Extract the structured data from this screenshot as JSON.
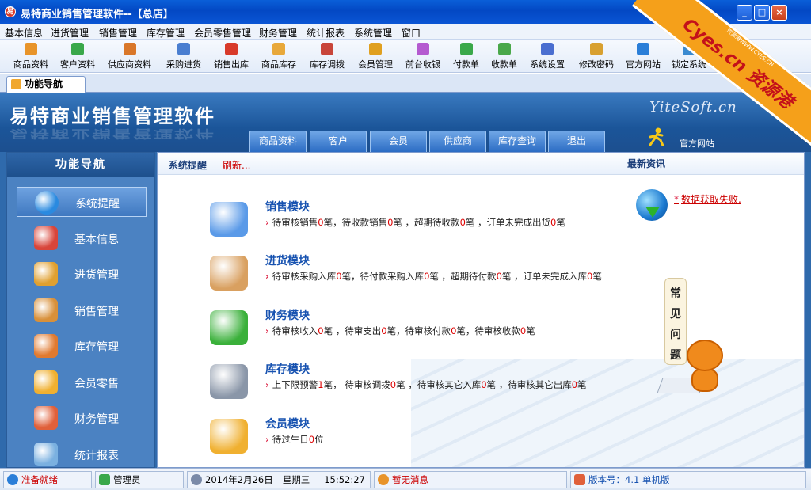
{
  "window": {
    "title": "易特商业销售管理软件--【总店】",
    "controls": [
      "_",
      "□",
      "×"
    ]
  },
  "menu": [
    "基本信息",
    "进货管理",
    "销售管理",
    "库存管理",
    "会员零售管理",
    "财务管理",
    "统计报表",
    "系统管理",
    "窗口"
  ],
  "toolbar": [
    {
      "label": "商品资料",
      "icon": "box-icon",
      "color": "#e8942a"
    },
    {
      "label": "客户资料",
      "icon": "customers-icon",
      "color": "#3aa84a"
    },
    {
      "label": "供应商资料",
      "icon": "supplier-icon",
      "color": "#d9772a"
    },
    {
      "label": "采购进货",
      "icon": "truck-icon",
      "color": "#4a7ed0"
    },
    {
      "label": "销售出库",
      "icon": "cart-icon",
      "color": "#d83a2a"
    },
    {
      "label": "商品库存",
      "icon": "inventory-icon",
      "color": "#e8a83a"
    },
    {
      "label": "库存调拨",
      "icon": "transfer-icon",
      "color": "#c8453a"
    },
    {
      "label": "会员管理",
      "icon": "member-icon",
      "color": "#e0a020"
    },
    {
      "label": "前台收银",
      "icon": "cashier-icon",
      "color": "#b45ad0"
    },
    {
      "label": "付款单",
      "icon": "payment-icon",
      "color": "#3aa84a"
    },
    {
      "label": "收款单",
      "icon": "receipt-icon",
      "color": "#4aa84a"
    },
    {
      "label": "系统设置",
      "icon": "settings-icon",
      "color": "#4a6ed0"
    },
    {
      "label": "修改密码",
      "icon": "key-icon",
      "color": "#d8a030"
    },
    {
      "label": "官方网站",
      "icon": "ie-icon",
      "color": "#2a7ed8"
    },
    {
      "label": "锁定系统",
      "icon": "lock-icon",
      "color": "#3a8ad0"
    }
  ],
  "watermark": {
    "main": "Cyes.cn 资源港",
    "sub": "资源港WWW.CYES.CN"
  },
  "tab": {
    "label": "功能导航"
  },
  "banner": {
    "brand": "易特商业销售管理软件",
    "site_logo": "YiteSoft.cn",
    "tabs": [
      "商品资料",
      "客户",
      "会员",
      "供应商",
      "库存查询",
      "退出"
    ],
    "official_site": "官方网站"
  },
  "sidebar": {
    "header": "功能导航",
    "items": [
      {
        "label": "系统提醒",
        "icon": "info-icon",
        "color": "#2a8ae0"
      },
      {
        "label": "基本信息",
        "icon": "cubes-icon",
        "color": "#d8453a"
      },
      {
        "label": "进货管理",
        "icon": "incoming-box-icon",
        "color": "#e0a030"
      },
      {
        "label": "销售管理",
        "icon": "outgoing-box-icon",
        "color": "#d8903a"
      },
      {
        "label": "库存管理",
        "icon": "warehouse-icon",
        "color": "#e07a30"
      },
      {
        "label": "会员零售",
        "icon": "member-chat-icon",
        "color": "#f0b030"
      },
      {
        "label": "财务管理",
        "icon": "finance-icon",
        "color": "#e0603a"
      },
      {
        "label": "统计报表",
        "icon": "report-icon",
        "color": "#7ab0e0"
      }
    ]
  },
  "content": {
    "reminder_title": "系统提醒",
    "refresh_link": "刷新...",
    "news_title": "最新资讯",
    "news_message": "数据获取失败.",
    "modules": [
      {
        "title": "销售模块",
        "desc": "待审核销售0笔，待收款销售0笔 ，超期待收款0笔 ，订单未完成出货0笔",
        "icon": "book-icon",
        "color": "#5a9ae8"
      },
      {
        "title": "进货模块",
        "desc": "待审核采购入库0笔，待付款采购入库0笔 ，超期待付款0笔 ，订单未完成入库0笔",
        "icon": "box-in-icon",
        "color": "#d9a060"
      },
      {
        "title": "财务模块",
        "desc": "待审核收入0笔 ，待审支出0笔，待审核付款0笔，待审核收款0笔",
        "icon": "dollar-icon",
        "color": "#3ab03a"
      },
      {
        "title": "库存模块",
        "desc": "上下限预警1笔， 待审核调拨0笔 ，待审核其它入库0笔 ，待审核其它出库0笔",
        "icon": "database-icon",
        "color": "#8a96a8"
      },
      {
        "title": "会员模块",
        "desc": "待过生日0位",
        "icon": "member-bubble-icon",
        "color": "#f0b030"
      }
    ],
    "faq": "常见问题"
  },
  "status": {
    "ready": "准备就绪",
    "user": "管理员",
    "date": "2014年2月26日",
    "weekday": "星期三",
    "time": "15:52:27",
    "message": "暂无消息",
    "version": "版本号：4.1 单机版"
  }
}
